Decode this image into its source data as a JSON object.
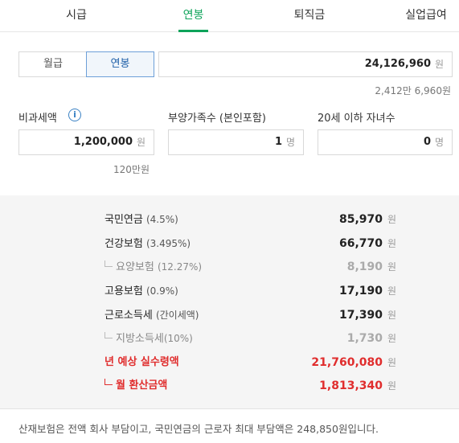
{
  "tabs": [
    {
      "label": "시급"
    },
    {
      "label": "연봉",
      "active": true
    },
    {
      "label": "퇴직금"
    },
    {
      "label": "실업급여"
    }
  ],
  "pay_toggle": {
    "monthly": "월급",
    "annual": "연봉",
    "selected": "annual"
  },
  "salary": {
    "value": "24,126,960",
    "unit": "원",
    "hint": "2,412만 6,960원"
  },
  "nontax": {
    "label": "비과세액",
    "info_icon": "info-icon",
    "value": "1,200,000",
    "unit": "원",
    "hint": "120만원"
  },
  "dependents": {
    "label": "부양가족수 (본인포함)",
    "value": "1",
    "unit": "명"
  },
  "children": {
    "label": "20세 이하 자녀수",
    "value": "0",
    "unit": "명"
  },
  "results": [
    {
      "name": "국민연금",
      "paren": "(4.5%)",
      "value": "85,970",
      "unit": "원"
    },
    {
      "name": "건강보험",
      "paren": "(3.495%)",
      "value": "66,770",
      "unit": "원"
    },
    {
      "name": "요양보험",
      "paren": "(12.27%)",
      "value": "8,190",
      "unit": "원"
    },
    {
      "name": "고용보험",
      "paren": "(0.9%)",
      "value": "17,190",
      "unit": "원"
    },
    {
      "name": "근로소득세",
      "paren": "(간이세액)",
      "value": "17,390",
      "unit": "원"
    },
    {
      "name": "지방소득세",
      "paren": "(10%)",
      "value": "1,730",
      "unit": "원"
    },
    {
      "name": "년 예상 실수령액",
      "paren": "",
      "value": "21,760,080",
      "unit": "원"
    },
    {
      "name": "월 환산금액",
      "paren": "",
      "value": "1,813,340",
      "unit": "원"
    }
  ],
  "footer": "산재보험은 전액 회사 부담이고, 국민연금의 근로자 최대 부담액은 248,850원입니다.",
  "colors": {
    "accent": "#0ea35a",
    "highlight": "#e02d2d",
    "toggle_selected": "#6d9fd8"
  }
}
